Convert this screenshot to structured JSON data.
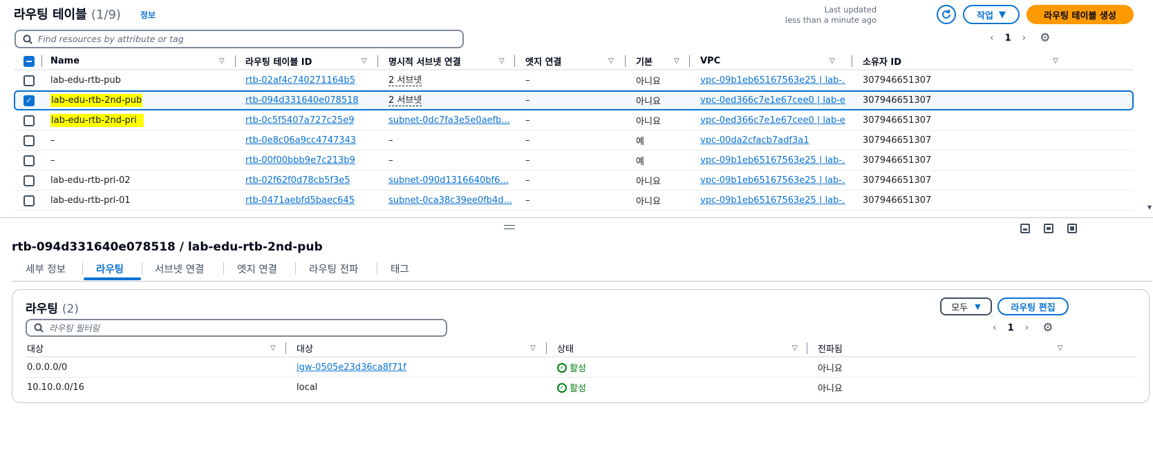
{
  "header": {
    "title": "라우팅 테이블",
    "count": "(1/9)",
    "info": "정보",
    "last_updated_line1": "Last updated",
    "last_updated_line2": "less than a minute ago",
    "action_label": "작업",
    "create_label": "라우팅 테이블 생성"
  },
  "search": {
    "placeholder": "Find resources by attribute or tag"
  },
  "pagination": {
    "page": "1"
  },
  "table": {
    "columns": [
      "Name",
      "라우팅 테이블 ID",
      "명시적 서브넷 연결",
      "엣지 연결",
      "기본",
      "VPC",
      "소유자 ID"
    ],
    "rows": [
      {
        "name": "lab-edu-rtb-pub",
        "id": "rtb-02af4c740271164b5",
        "subnet": "2 서브넷",
        "edge": "–",
        "main": "아니요",
        "vpc": "vpc-09b1eb65167563e25 | lab-...",
        "owner": "307946651307"
      },
      {
        "name": "lab-edu-rtb-2nd-pub",
        "id": "rtb-094d331640e078518",
        "subnet": "2 서브넷",
        "edge": "–",
        "main": "아니요",
        "vpc": "vpc-0ed366c7e1e67cee0 | lab-e...",
        "owner": "307946651307"
      },
      {
        "name": "lab-edu-rtb-2nd-pri",
        "id": "rtb-0c5f5407a727c25e9",
        "subnet": "subnet-0dc7fa3e5e0aefb...",
        "edge": "–",
        "main": "아니요",
        "vpc": "vpc-0ed366c7e1e67cee0 | lab-e...",
        "owner": "307946651307"
      },
      {
        "name": "–",
        "id": "rtb-0e8c06a9cc4747343",
        "subnet": "–",
        "edge": "–",
        "main": "예",
        "vpc": "vpc-00da2cfacb7adf3a1",
        "owner": "307946651307"
      },
      {
        "name": "–",
        "id": "rtb-00f00bbb9e7c213b9",
        "subnet": "–",
        "edge": "–",
        "main": "예",
        "vpc": "vpc-09b1eb65167563e25 | lab-...",
        "owner": "307946651307"
      },
      {
        "name": "lab-edu-rtb-pri-02",
        "id": "rtb-02f62f0d78cb5f3e5",
        "subnet": "subnet-090d1316640bf6...",
        "edge": "–",
        "main": "아니요",
        "vpc": "vpc-09b1eb65167563e25 | lab-...",
        "owner": "307946651307"
      },
      {
        "name": "lab-edu-rtb-pri-01",
        "id": "rtb-0471aebfd5baec645",
        "subnet": "subnet-0ca38c39ee0fb4d...",
        "edge": "–",
        "main": "아니요",
        "vpc": "vpc-09b1eb65167563e25 | lab-...",
        "owner": "307946651307"
      }
    ]
  },
  "detail": {
    "title": "rtb-094d331640e078518 / lab-edu-rtb-2nd-pub",
    "tabs": [
      "세부 정보",
      "라우팅",
      "서브넷 연결",
      "엣지 연결",
      "라우팅 전파",
      "태그"
    ],
    "routes_title": "라우팅",
    "routes_count": "(2)",
    "all_label": "모두",
    "edit_label": "라우팅 편집",
    "filter_placeholder": "라우팅 필터링",
    "page": "1",
    "columns": [
      "대상",
      "대상",
      "상태",
      "전파됨"
    ],
    "rows": [
      {
        "destination": "0.0.0.0/0",
        "target": "igw-0505e23d36ca8f71f",
        "status": "활성",
        "propagated": "아니요"
      },
      {
        "destination": "10.10.0.0/16",
        "target": "local",
        "status": "활성",
        "propagated": "아니요"
      }
    ]
  },
  "colors": {
    "accent": "#0972d3",
    "primary_button": "#ff9900",
    "highlight": "#ffff00",
    "success": "#037f0c"
  }
}
